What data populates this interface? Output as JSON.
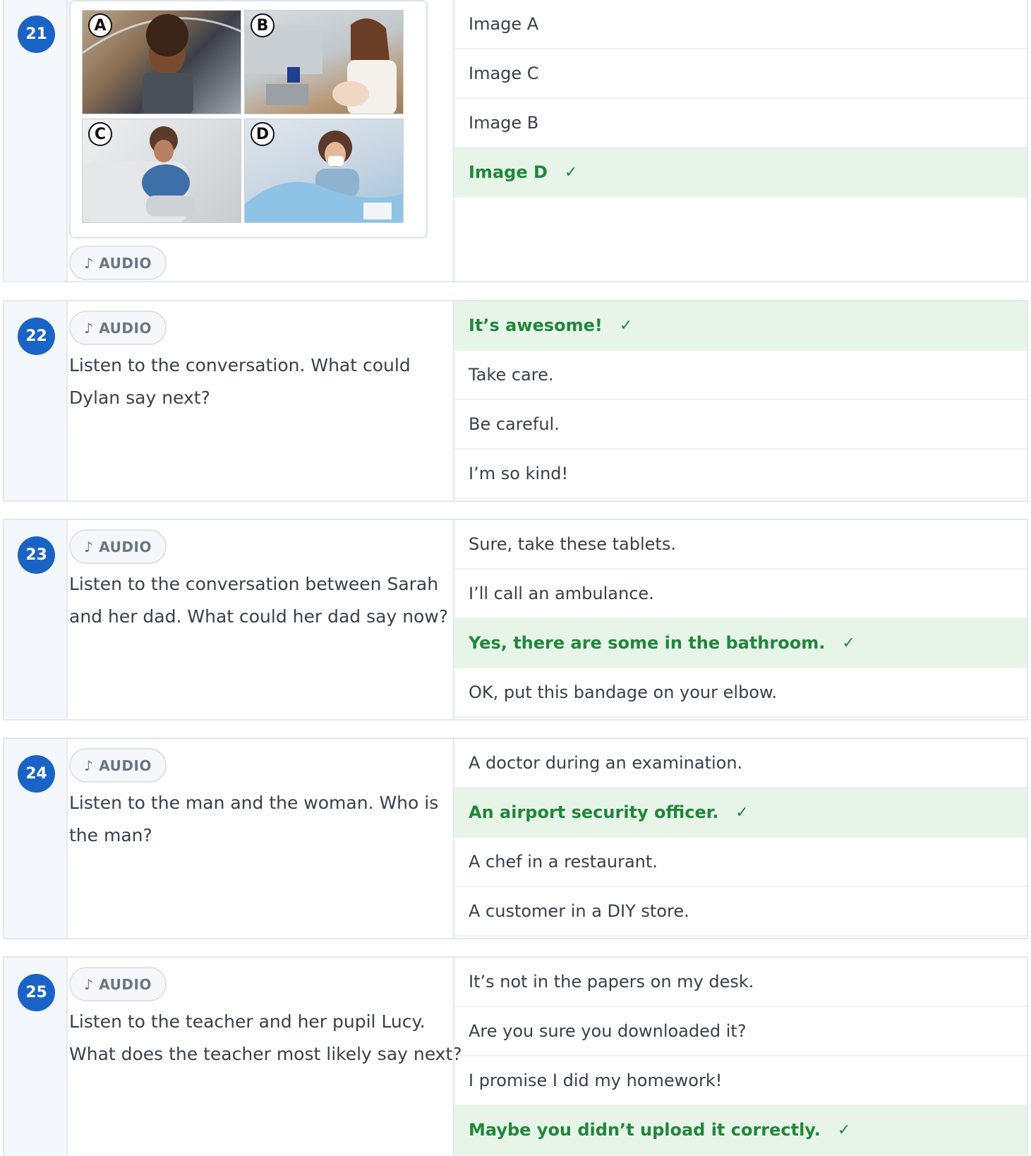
{
  "audio_label": "AUDIO",
  "check_mark": "✓",
  "questions": [
    {
      "number": "21",
      "prompt": "",
      "image_labels": [
        "A",
        "B",
        "C",
        "D"
      ],
      "options": [
        {
          "text": "Image A",
          "correct": false
        },
        {
          "text": "Image C",
          "correct": false
        },
        {
          "text": "Image B",
          "correct": false
        },
        {
          "text": "Image D",
          "correct": true
        }
      ]
    },
    {
      "number": "22",
      "prompt": "Listen to the conversation. What could Dylan say next?",
      "options": [
        {
          "text": "It’s awesome!",
          "correct": true
        },
        {
          "text": "Take care.",
          "correct": false
        },
        {
          "text": "Be careful.",
          "correct": false
        },
        {
          "text": "I’m so kind!",
          "correct": false
        }
      ]
    },
    {
      "number": "23",
      "prompt": "Listen to the conversation between Sarah and her dad. What could her dad say now?",
      "options": [
        {
          "text": "Sure, take these tablets.",
          "correct": false
        },
        {
          "text": "I’ll call an ambulance.",
          "correct": false
        },
        {
          "text": "Yes, there are some in the bathroom.",
          "correct": true
        },
        {
          "text": "OK, put this bandage on your elbow.",
          "correct": false
        }
      ]
    },
    {
      "number": "24",
      "prompt": "Listen to the man and the woman. Who is the man?",
      "options": [
        {
          "text": "A doctor during an examination.",
          "correct": false
        },
        {
          "text": "An airport security officer.",
          "correct": true
        },
        {
          "text": "A chef in a restaurant.",
          "correct": false
        },
        {
          "text": "A customer in a DIY store.",
          "correct": false
        }
      ]
    },
    {
      "number": "25",
      "prompt": "Listen to the teacher and her pupil Lucy. What does the teacher most likely say next?",
      "options": [
        {
          "text": "It’s not in the papers on my desk.",
          "correct": false
        },
        {
          "text": "Are you sure you downloaded it?",
          "correct": false
        },
        {
          "text": "I promise I did my homework!",
          "correct": false
        },
        {
          "text": "Maybe you didn’t upload it correctly.",
          "correct": true
        }
      ]
    }
  ]
}
